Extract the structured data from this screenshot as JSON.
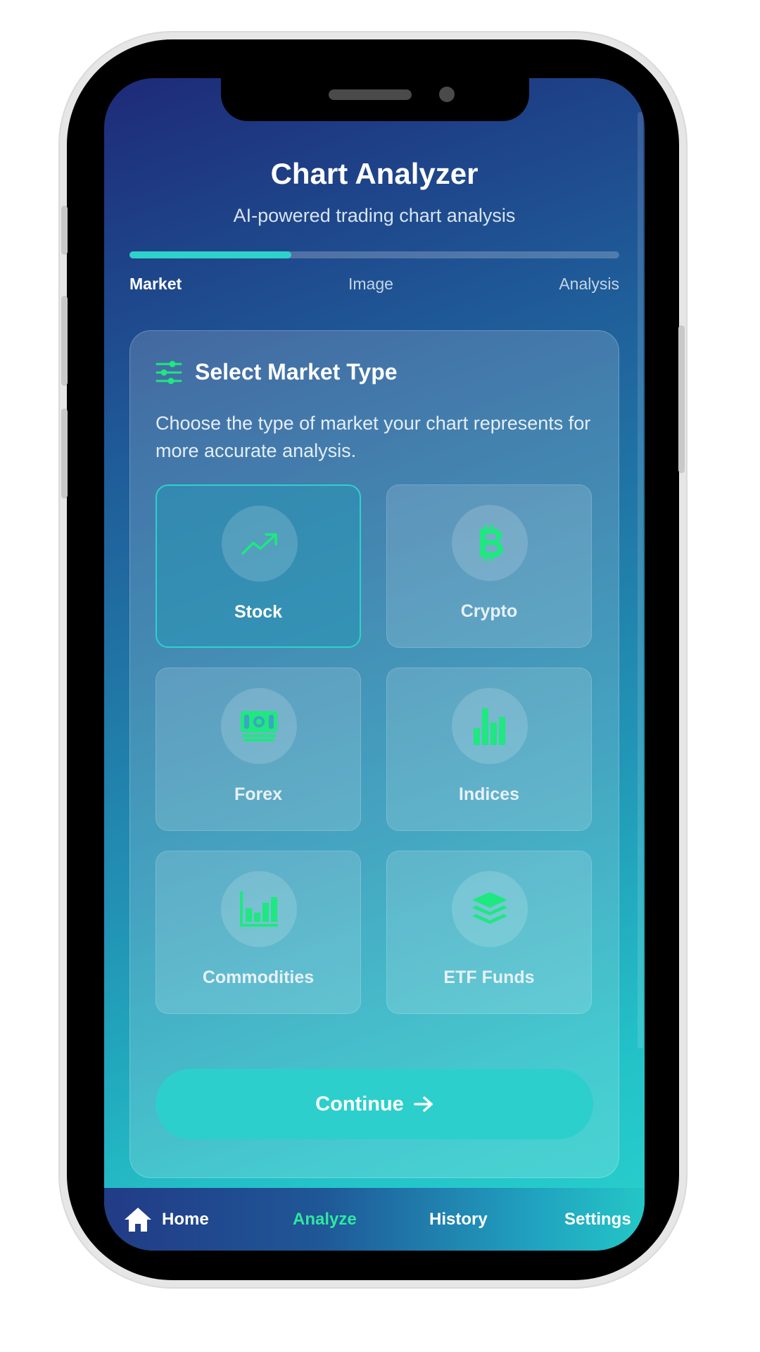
{
  "header": {
    "title": "Chart Analyzer",
    "subtitle": "AI-powered trading chart analysis"
  },
  "progress": {
    "value": 0.33,
    "steps": [
      {
        "label": "Market",
        "active": true
      },
      {
        "label": "Image",
        "active": false
      },
      {
        "label": "Analysis",
        "active": false
      }
    ]
  },
  "card": {
    "title": "Select Market Type",
    "description": "Choose the type of market your chart represents for more accurate analysis.",
    "header_icon": "sliders-icon"
  },
  "markets": [
    {
      "label": "Stock",
      "icon": "trending-up-icon",
      "selected": true
    },
    {
      "label": "Crypto",
      "icon": "bitcoin-icon",
      "selected": false
    },
    {
      "label": "Forex",
      "icon": "money-bill-icon",
      "selected": false
    },
    {
      "label": "Indices",
      "icon": "bar-chart-icon",
      "selected": false
    },
    {
      "label": "Commodities",
      "icon": "chart-column-icon",
      "selected": false
    },
    {
      "label": "ETF Funds",
      "icon": "layers-icon",
      "selected": false
    }
  ],
  "continue_button": {
    "label": "Continue",
    "icon": "arrow-right-icon"
  },
  "nav": {
    "items": [
      {
        "label": "Home",
        "icon": "home-icon",
        "active": false
      },
      {
        "label": "Analyze",
        "active": true
      },
      {
        "label": "History",
        "active": false
      },
      {
        "label": "Settings",
        "active": false
      }
    ]
  },
  "colors": {
    "accent": "#2fd1cb",
    "icon_green": "#1ee87f",
    "nav_active": "#2ee8a0",
    "bg_top": "#1e2a78",
    "bg_bottom": "#29d0cc"
  }
}
